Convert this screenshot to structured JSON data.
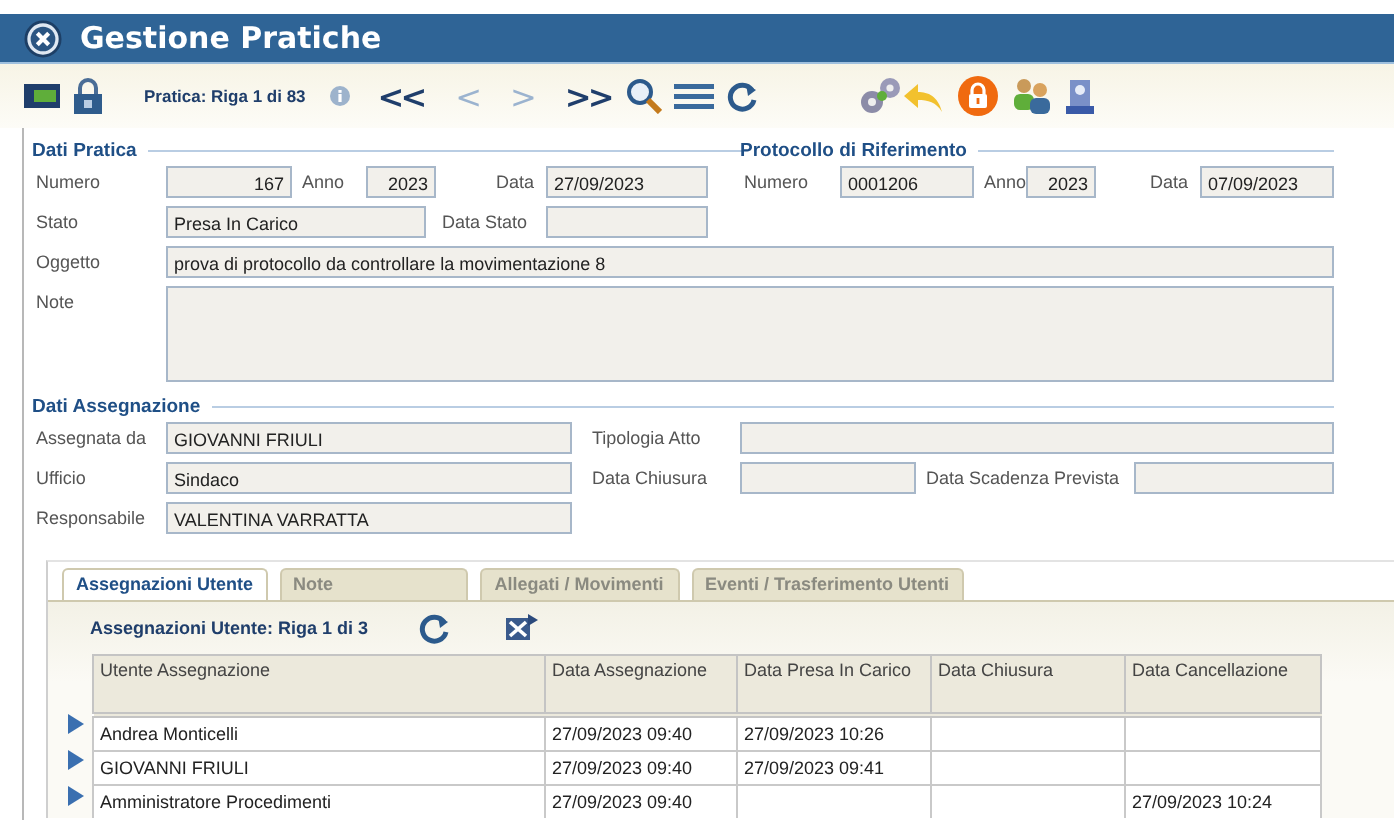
{
  "window": {
    "title": "Gestione Pratiche"
  },
  "toolbar": {
    "record_label": "Pratica: Riga 1 di 83",
    "nav": [
      {
        "symbol": "<<",
        "disabled": false
      },
      {
        "symbol": "<",
        "disabled": true
      },
      {
        "symbol": ">",
        "disabled": true
      },
      {
        "symbol": ">>",
        "disabled": false
      }
    ]
  },
  "dati_pratica": {
    "title": "Dati Pratica",
    "numero": {
      "label": "Numero",
      "value": "167"
    },
    "anno": {
      "label": "Anno",
      "value": "2023"
    },
    "data": {
      "label": "Data",
      "value": "27/09/2023"
    },
    "stato": {
      "label": "Stato",
      "value": "Presa In Carico"
    },
    "data_stato": {
      "label": "Data Stato"
    },
    "oggetto": {
      "label": "Oggetto",
      "value": "prova di protocollo da controllare la movimentazione 8"
    },
    "note": {
      "label": "Note"
    }
  },
  "protocollo": {
    "title": "Protocollo di Riferimento",
    "numero": {
      "label": "Numero",
      "value": "0001206"
    },
    "anno": {
      "label": "Anno",
      "value": "2023"
    },
    "data": {
      "label": "Data",
      "value": "07/09/2023"
    }
  },
  "dati_assegnazione": {
    "title": "Dati Assegnazione",
    "assegnata_da": {
      "label": "Assegnata da",
      "value": "GIOVANNI FRIULI"
    },
    "tipologia_atto": {
      "label": "Tipologia Atto"
    },
    "ufficio": {
      "label": "Ufficio",
      "value": "Sindaco"
    },
    "data_chiusura": {
      "label": "Data Chiusura"
    },
    "data_scadenza": {
      "label": "Data Scadenza Prevista"
    },
    "responsabile": {
      "label": "Responsabile",
      "value": "VALENTINA VARRATTA"
    }
  },
  "tabs": [
    {
      "label": "Assegnazioni Utente",
      "selected": true
    },
    {
      "label": "Note",
      "selected": false
    },
    {
      "label": "Allegati / Movimenti",
      "selected": false
    },
    {
      "label": "Eventi / Trasferimento Utenti",
      "selected": false
    }
  ],
  "grid": {
    "title": "Assegnazioni Utente: Riga 1 di 3",
    "columns": [
      "Utente Assegnazione",
      "Data Assegnazione",
      "Data Presa In Carico",
      "Data Chiusura",
      "Data Cancellazione"
    ],
    "rows": [
      [
        "Andrea Monticelli",
        "27/09/2023 09:40",
        "27/09/2023 10:26",
        "",
        ""
      ],
      [
        "GIOVANNI FRIULI",
        "27/09/2023 09:40",
        "27/09/2023 09:41",
        "",
        ""
      ],
      [
        "Amministratore Procedimenti",
        "27/09/2023 09:40",
        "",
        "",
        "27/09/2023 10:24"
      ]
    ]
  }
}
